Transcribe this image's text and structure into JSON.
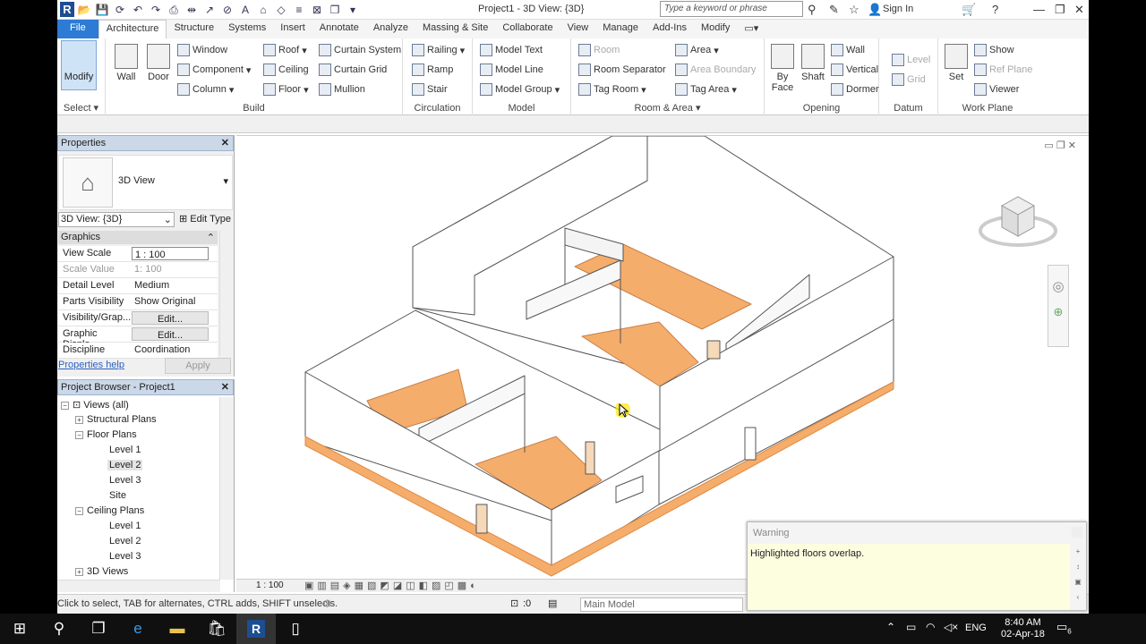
{
  "window": {
    "title": "Project1 - 3D View: {3D}",
    "search_placeholder": "Type a keyword or phrase",
    "signin": "Sign In"
  },
  "tabs": [
    "File",
    "Architecture",
    "Structure",
    "Systems",
    "Insert",
    "Annotate",
    "Analyze",
    "Massing & Site",
    "Collaborate",
    "View",
    "Manage",
    "Add-Ins",
    "Modify"
  ],
  "ribbon": {
    "select": {
      "modify": "Modify",
      "label": "Select ▾"
    },
    "build": {
      "wall": "Wall",
      "door": "Door",
      "window": "Window",
      "component": "Component",
      "column": "Column",
      "roof": "Roof",
      "ceiling": "Ceiling",
      "floor": "Floor",
      "curtain_system": "Curtain System",
      "curtain_grid": "Curtain Grid",
      "mullion": "Mullion",
      "label": "Build"
    },
    "circulation": {
      "railing": "Railing",
      "ramp": "Ramp",
      "stair": "Stair",
      "label": "Circulation"
    },
    "model": {
      "text": "Model Text",
      "line": "Model Line",
      "group": "Model Group",
      "label": "Model"
    },
    "room_area": {
      "room": "Room",
      "room_separator": "Room Separator",
      "tag_room": "Tag Room",
      "area": "Area",
      "area_boundary": "Area Boundary",
      "tag_area": "Tag Area",
      "label": "Room & Area ▾"
    },
    "opening": {
      "by_face": "By Face",
      "shaft": "Shaft",
      "wall": "Wall",
      "vertical": "Vertical",
      "dormer": "Dormer",
      "label": "Opening"
    },
    "datum": {
      "level": "Level",
      "grid": "Grid",
      "label": "Datum"
    },
    "work_plane": {
      "set": "Set",
      "show": "Show",
      "ref_plane": "Ref Plane",
      "viewer": "Viewer",
      "label": "Work Plane"
    }
  },
  "properties": {
    "title": "Properties",
    "type_name": "3D View",
    "view_selector": "3D View: {3D}",
    "edit_type": "Edit Type",
    "group": "Graphics",
    "rows": [
      {
        "k": "View Scale",
        "v": "1 : 100"
      },
      {
        "k": "Scale Value",
        "v": "1:  100"
      },
      {
        "k": "Detail Level",
        "v": "Medium"
      },
      {
        "k": "Parts Visibility",
        "v": "Show Original"
      },
      {
        "k": "Visibility/Grap...",
        "v": "Edit..."
      },
      {
        "k": "Graphic Displa...",
        "v": "Edit..."
      },
      {
        "k": "Discipline",
        "v": "Coordination"
      }
    ],
    "help": "Properties help",
    "apply": "Apply"
  },
  "browser": {
    "title": "Project Browser - Project1",
    "items": [
      "Views (all)",
      "Structural Plans",
      "Floor Plans",
      "Level 1",
      "Level 2",
      "Level 3",
      "Site",
      "Ceiling Plans",
      "Level 1",
      "Level 2",
      "Level 3",
      "3D Views"
    ]
  },
  "view_control": {
    "scale": "1 : 100"
  },
  "status": {
    "text": "Click to select, TAB for alternates, CTRL adds, SHIFT unselects.",
    "workset": ":0",
    "main_model": "Main Model"
  },
  "warning": {
    "title": "Warning",
    "message": "Highlighted floors overlap."
  },
  "taskbar": {
    "lang": "ENG",
    "time": "8:40 AM",
    "date": "02-Apr-18",
    "notifications": "6"
  },
  "colors": {
    "floor": "#f5ad6b",
    "floor_dark": "#e89a55",
    "accent": "#2d7bd4"
  }
}
